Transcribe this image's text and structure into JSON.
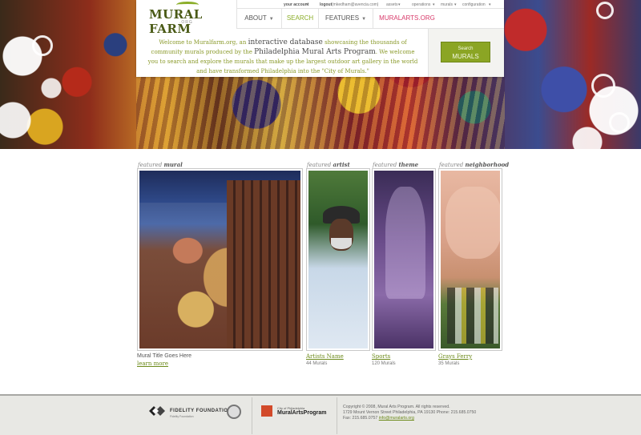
{
  "brand": {
    "logo_text": "MURAL FARM",
    "logo_sub": ".ORG"
  },
  "utility": {
    "account": "your account",
    "logout": "logout",
    "email": "(mkedham@avencia.com)",
    "assets": "assets",
    "operations": "operations",
    "murals": "murals",
    "configuration": "configuration",
    "reports": "reports"
  },
  "nav": {
    "about": "ABOUT",
    "search": "SEARCH",
    "features": "FEATURES",
    "muralarts": "MURALARTS.ORG"
  },
  "welcome": {
    "p1": "Welcome to Muralfarm.org, an ",
    "p1_big": "interactive database",
    "p2": " showcasing the thousands of community murals produced by the ",
    "p2_big": "Philadelphia Mural Arts Program",
    "p3": ". We welcome you to search and explore the murals that make up the largest outdoor art gallery in the world and have transformed Philadelphia into the \"City of Murals.\""
  },
  "search_button": {
    "line1": "Search",
    "line2": "MURALS"
  },
  "featured": {
    "prefix": "featured",
    "mural": {
      "label": "mural",
      "title": "Mural Title Goes Here",
      "link": "learn more"
    },
    "artist": {
      "label": "artist",
      "name": "Artists Name",
      "count": "44 Murals"
    },
    "theme": {
      "label": "theme",
      "name": "Sports",
      "count": "120 Murals"
    },
    "neighborhood": {
      "label": "neighborhood",
      "name": "Grays Ferry",
      "count": "35 Murals"
    }
  },
  "footer": {
    "fidelity": "FIDELITY FOUNDATION",
    "fidelity_sub": "Fidelity Foundation",
    "city": "City of Philadelphia",
    "map_name": "MuralArtsProgram",
    "copyright": "Copyright © 2008, Mural Arts Program. All rights reserved.",
    "address": "1729 Mount Vernon Street Philadelphia, PA 19130 Phone: 215.685.0750",
    "fax": "Fax: 215.685.0757",
    "email": "info@muralarts.org"
  },
  "colors": {
    "accent_green": "#8bae2a",
    "link_green": "#6c8a1a",
    "nav_pink": "#d83a6a"
  }
}
